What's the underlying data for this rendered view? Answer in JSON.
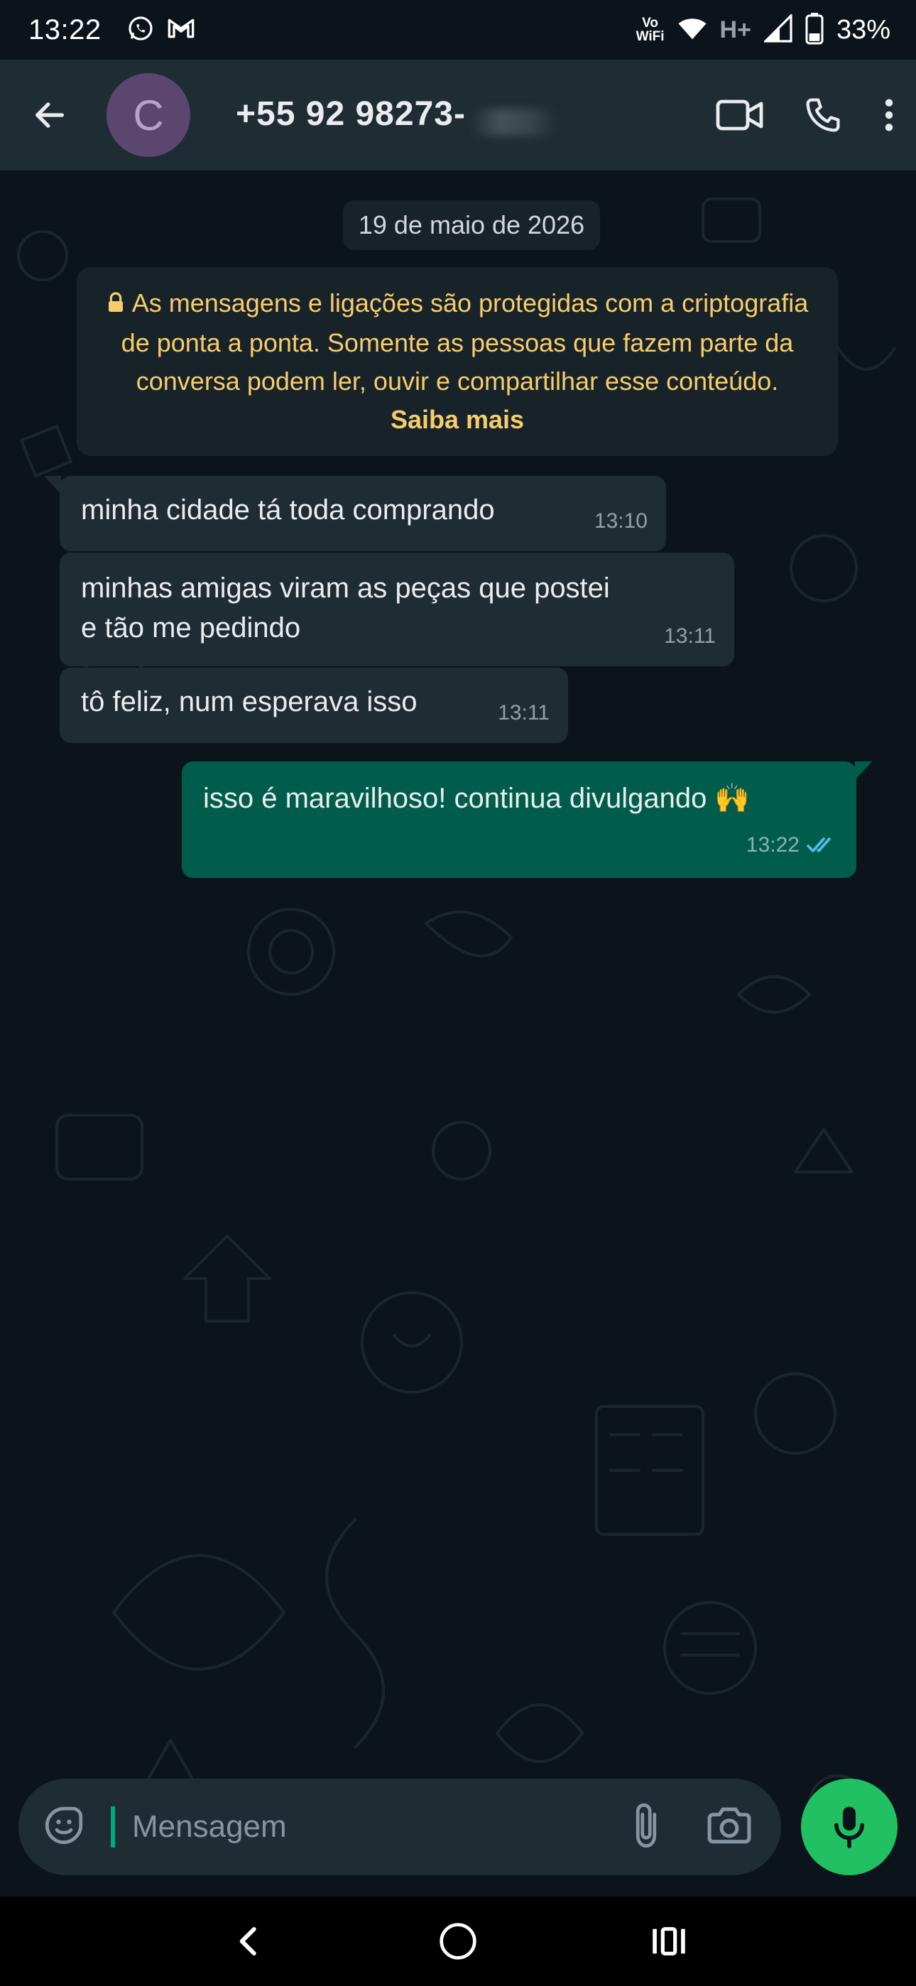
{
  "status_bar": {
    "time": "13:22",
    "left_icons": [
      "whatsapp-icon",
      "gmail-icon"
    ],
    "vowifi_top": "Vo",
    "vowifi_bottom": "WiFi",
    "network_type": "H+",
    "battery": "33%"
  },
  "header": {
    "avatar_letter": "C",
    "contact_number": "+55 92 98273-",
    "actions": [
      "video-call-icon",
      "voice-call-icon",
      "more-options-icon"
    ]
  },
  "chat": {
    "date": "19 de maio de 2026",
    "encryption_notice": {
      "text": "As mensagens e ligações são protegidas com a criptografia de ponta a ponta. Somente as pessoas que fazem parte da conversa podem ler, ouvir e compartilhar esse conteúdo.",
      "link": "Saiba mais"
    },
    "messages": [
      {
        "direction": "incoming",
        "text": "minha cidade tá toda comprando",
        "time": "13:10"
      },
      {
        "direction": "incoming",
        "text": "minhas amigas viram as peças que postei e tão me pedindo",
        "time": "13:11"
      },
      {
        "direction": "incoming",
        "text": "tô feliz, num esperava isso",
        "time": "13:11"
      },
      {
        "direction": "outgoing",
        "text": "isso é maravilhoso! continua divulgando 🙌",
        "time": "13:22",
        "status": "read"
      }
    ]
  },
  "composer": {
    "placeholder": "Mensagem",
    "icons": [
      "sticker-icon",
      "attach-icon",
      "camera-icon",
      "mic-icon"
    ]
  },
  "colors": {
    "background": "#0b141a",
    "header": "#1f2c34",
    "incoming_bubble": "#1f2c34",
    "outgoing_bubble": "#005c4b",
    "accent_green": "#21c063",
    "notice_text": "#f7cd6b",
    "read_ticks": "#53bdeb"
  },
  "nav": {
    "items": [
      "back-nav-icon",
      "home-nav-icon",
      "recents-nav-icon"
    ]
  }
}
